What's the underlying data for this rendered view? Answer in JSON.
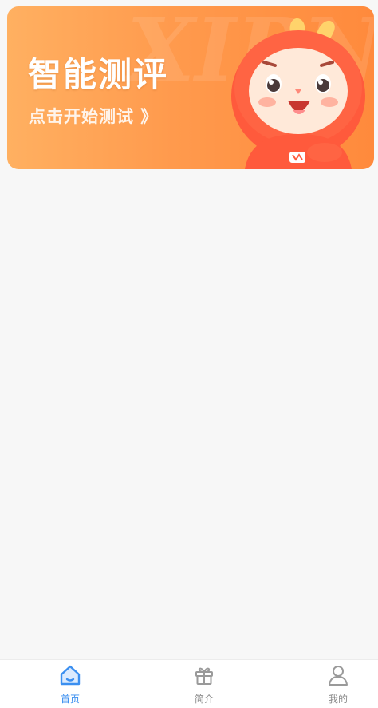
{
  "banner": {
    "title": "智能测评",
    "subtitle": "点击开始测试 》",
    "decorative_bg_text": "XIPNAO"
  },
  "tabbar": {
    "active_color": "#3b8ff0",
    "inactive_color": "#8a8a8a",
    "tabs": [
      {
        "label": "首页",
        "icon": "home-icon",
        "active": true
      },
      {
        "label": "简介",
        "icon": "gift-icon",
        "active": false
      },
      {
        "label": "我的",
        "icon": "user-icon",
        "active": false
      }
    ]
  }
}
